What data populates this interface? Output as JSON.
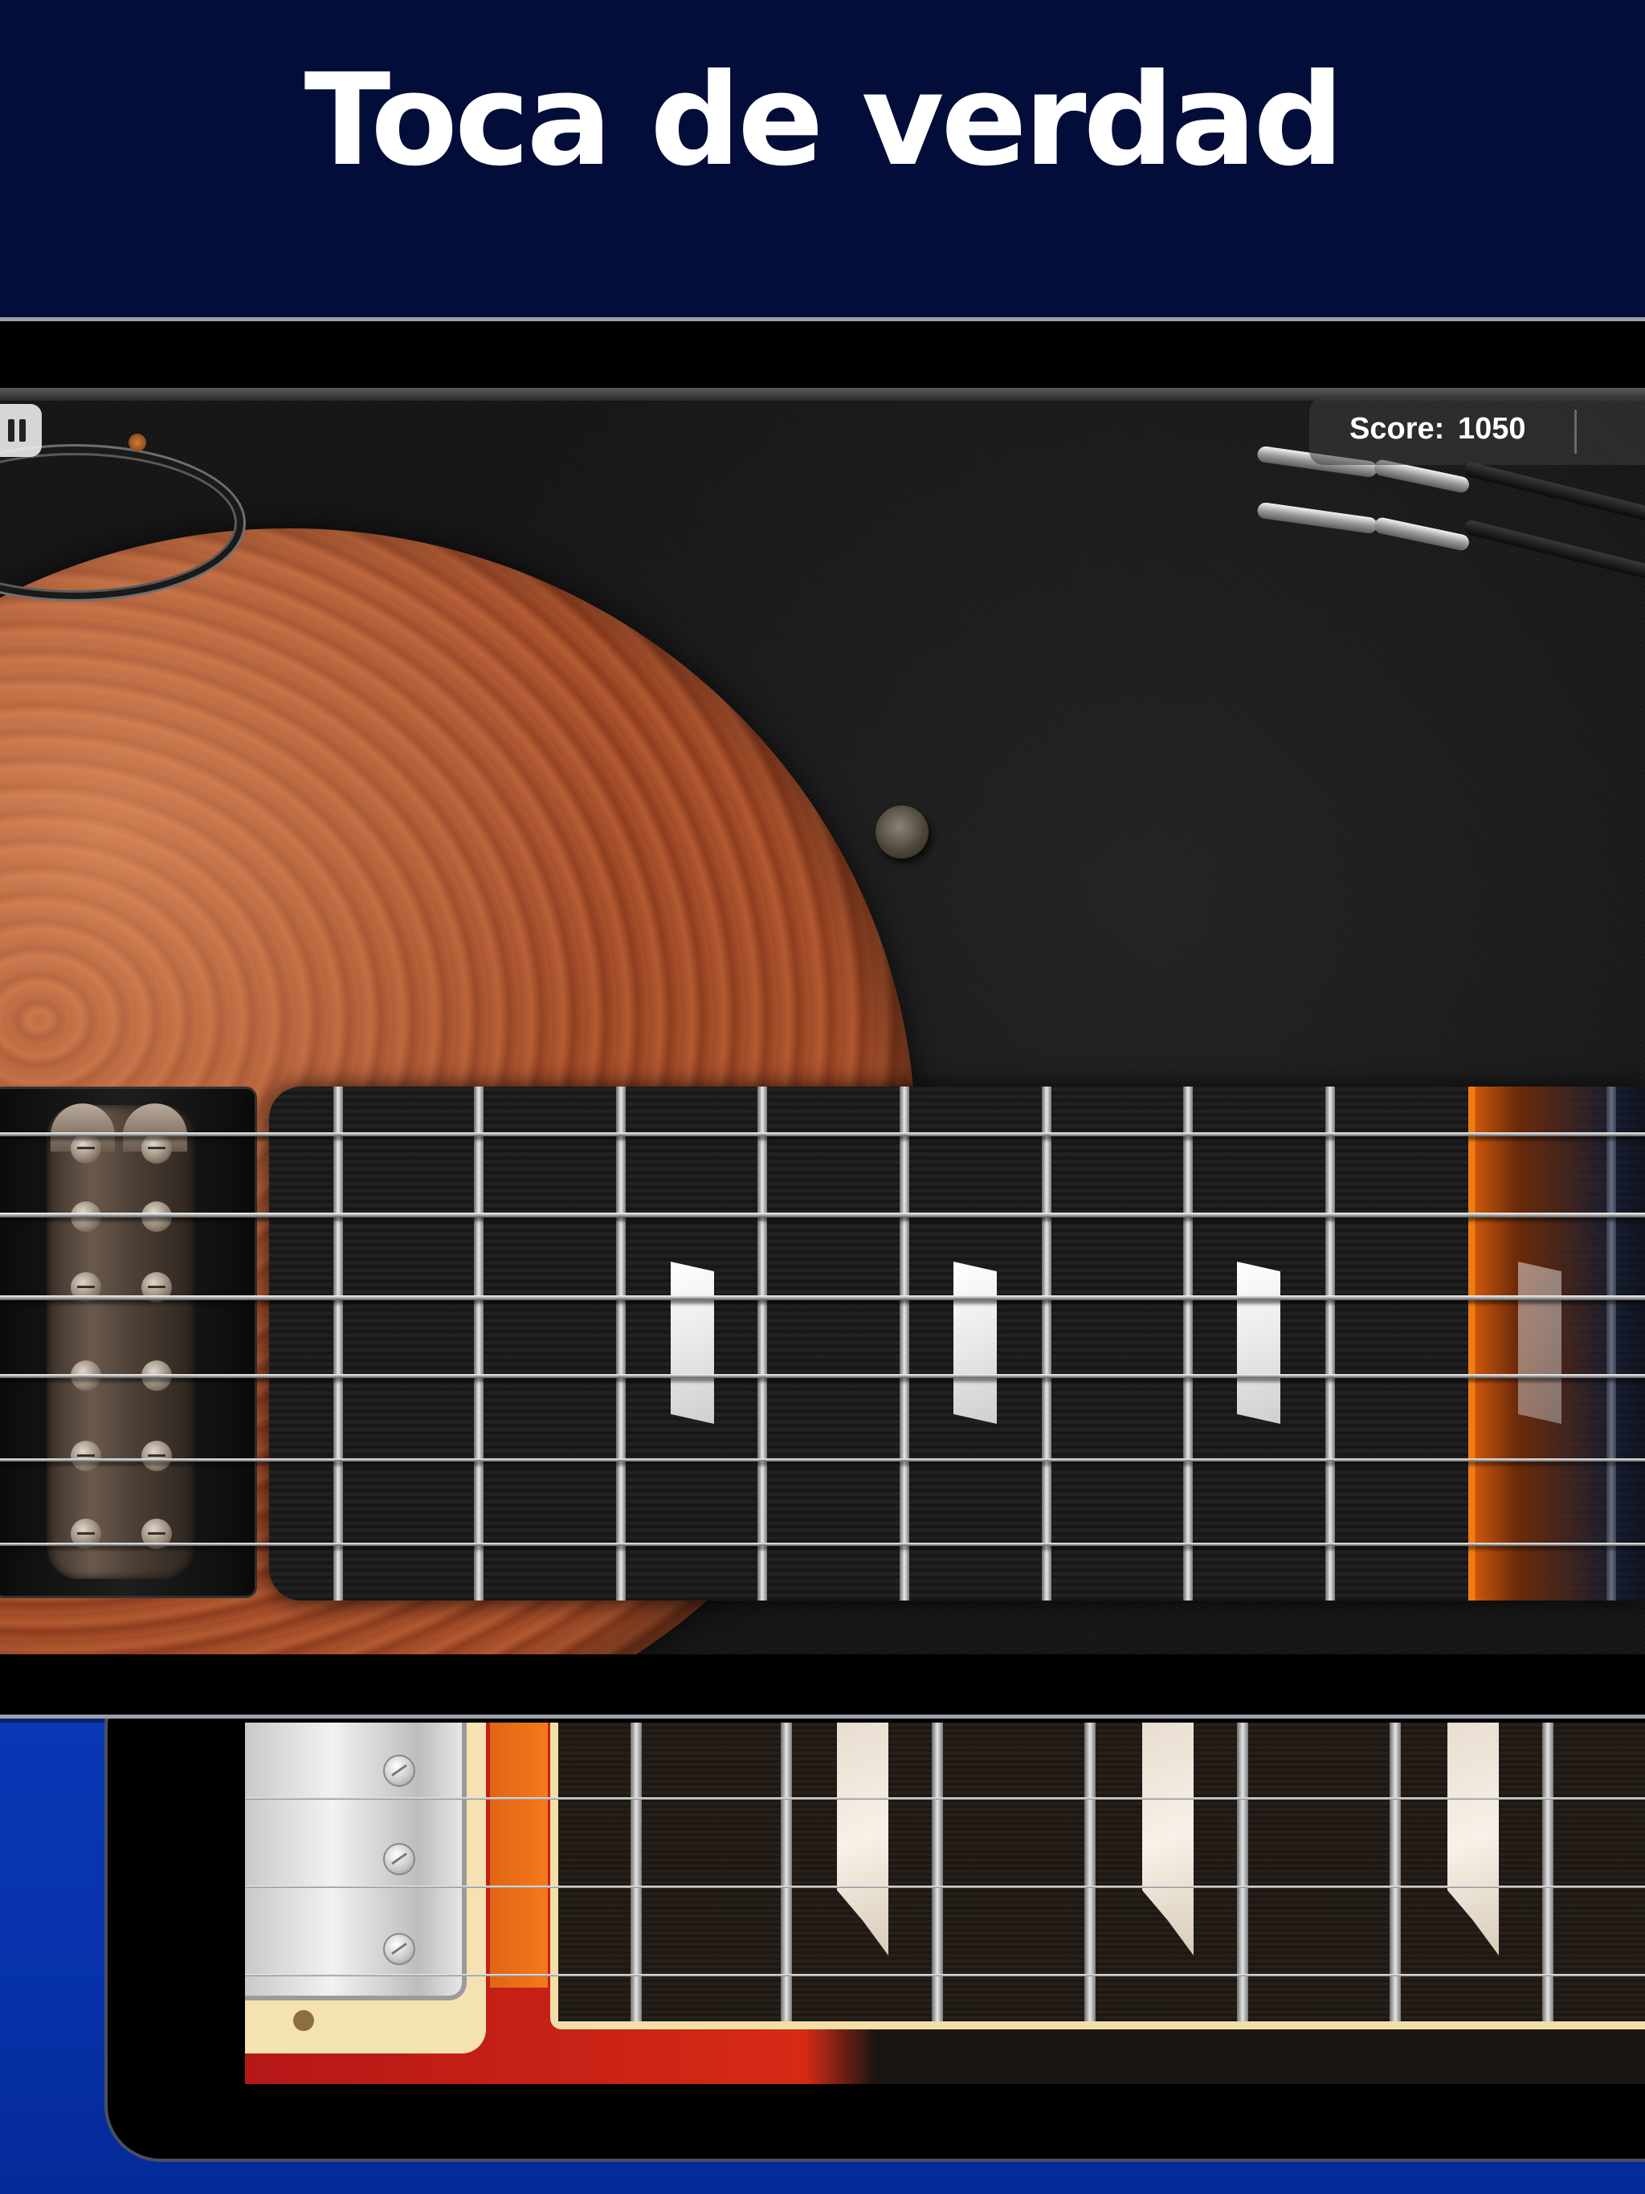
{
  "promo": {
    "title": "Toca de verdad"
  },
  "game": {
    "pause_button_label": "pause-icon",
    "score": {
      "label": "Score:",
      "value": "1050"
    }
  },
  "colors": {
    "header_bg": "#030d3a",
    "lower_bg": "#0a37b5",
    "highlight_accent": "#f27c12",
    "wood_body": "#a14a27",
    "red_body": "#d62a15"
  },
  "icons": [
    "pause-icon",
    "guitar-string-coil-icon",
    "jack-cable-icon",
    "knob-icon",
    "pickup-icon"
  ]
}
